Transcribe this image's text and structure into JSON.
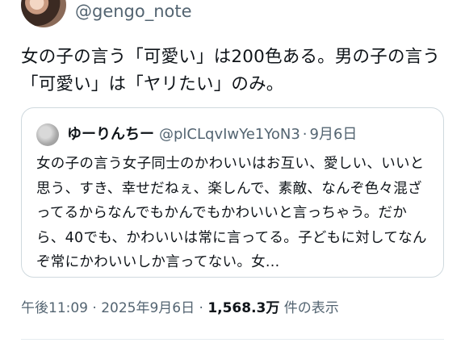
{
  "author": {
    "handle": "@gengo_note"
  },
  "tweet": {
    "text": "女の子の言う「可愛い」は200色ある。男の子の言う「可愛い」は「ヤリたい」のみ。"
  },
  "quote": {
    "name": "ゆーりんちー",
    "handle": "@plCLqvIwYe1YoN3",
    "separator": "·",
    "date": "9月6日",
    "text": "女の子の言う女子同士のかわいいはお互い、愛しい、いいと思う、すき、幸せだねぇ、楽しんで、素敵、なんぞ色々混ざってるからなんでもかんでもかわいいと言っちゃう。だから、40でも、かわいいは常に言ってる。子どもに対してなんぞ常にかわいいしか言ってない。女..."
  },
  "meta": {
    "time_date": "午後11:09 · 2025年9月6日 · ",
    "views": "1,568.3万",
    "views_label": " 件の表示"
  }
}
